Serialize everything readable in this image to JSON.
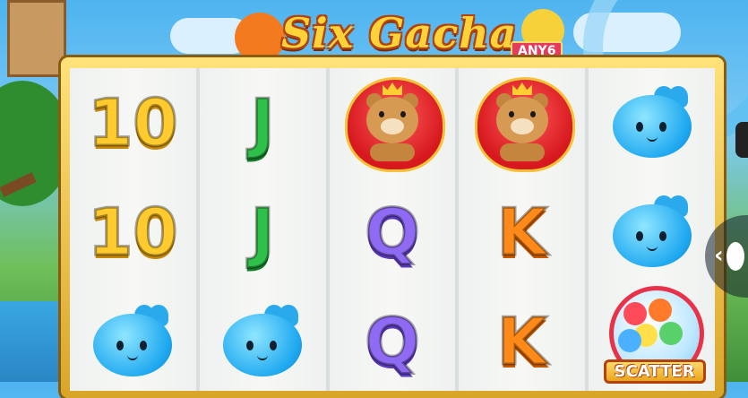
{
  "game": {
    "title": "Six Gacha",
    "badge": "ANY6"
  },
  "reels": [
    {
      "reel": 1,
      "symbols": [
        "10",
        "10",
        "blob"
      ]
    },
    {
      "reel": 2,
      "symbols": [
        "J",
        "J",
        "blob"
      ]
    },
    {
      "reel": 3,
      "symbols": [
        "bear",
        "Q",
        "Q"
      ]
    },
    {
      "reel": 4,
      "symbols": [
        "bear",
        "K",
        "K"
      ]
    },
    {
      "reel": 5,
      "symbols": [
        "blob",
        "blob",
        "scatter"
      ]
    }
  ],
  "symbol_labels": {
    "ten": "10",
    "jack": "J",
    "queen": "Q",
    "king": "K",
    "scatter": "SCATTER"
  },
  "colors": {
    "ten": "#ffcb2e",
    "jack": "#2fc04a",
    "queen": "#8f6af2",
    "king": "#ff8a1a",
    "frame": "#e6b93a"
  },
  "side_control": {
    "icon": "chevron-left-icon"
  }
}
